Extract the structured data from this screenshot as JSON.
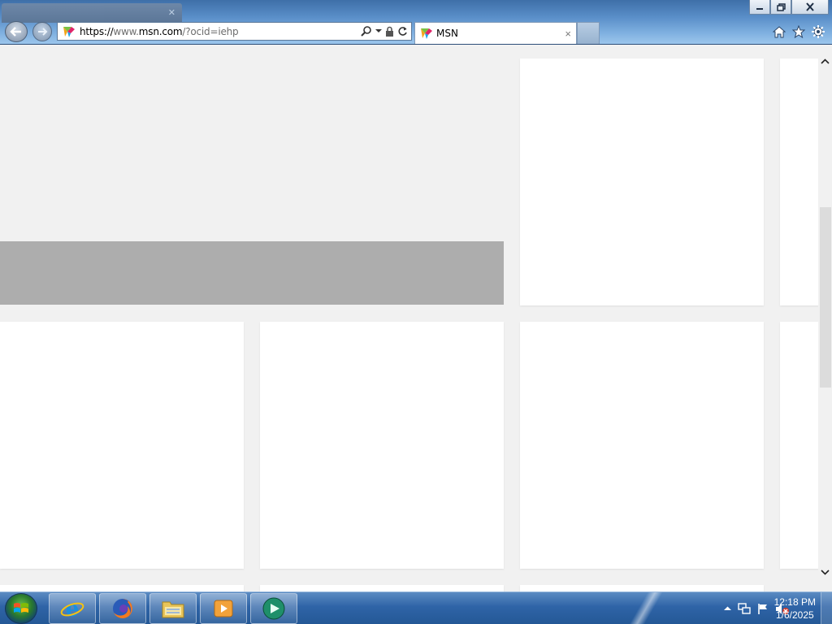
{
  "browser": {
    "address_url_scheme": "https://",
    "address_url_prefix": "www.",
    "address_url_host": "msn.com",
    "address_url_path": "/?ocid=iehp",
    "tab_title": "MSN",
    "tab_close": "×",
    "colors": {
      "frame": "#5a8fc9",
      "content_bg": "#f1f1f1",
      "banner": "#adadad"
    }
  },
  "icons": {
    "back": "back-arrow-icon",
    "forward": "forward-arrow-icon",
    "search": "search-icon",
    "lock": "lock-icon",
    "refresh": "refresh-icon",
    "home": "home-icon",
    "favorites": "favorites-star-icon",
    "tools": "gear-icon"
  },
  "taskbar": {
    "apps": [
      "internet-explorer",
      "firefox",
      "windows-explorer",
      "media-player",
      "media-center"
    ],
    "clock_time": "12:18 PM",
    "clock_date": "1/6/2025"
  }
}
